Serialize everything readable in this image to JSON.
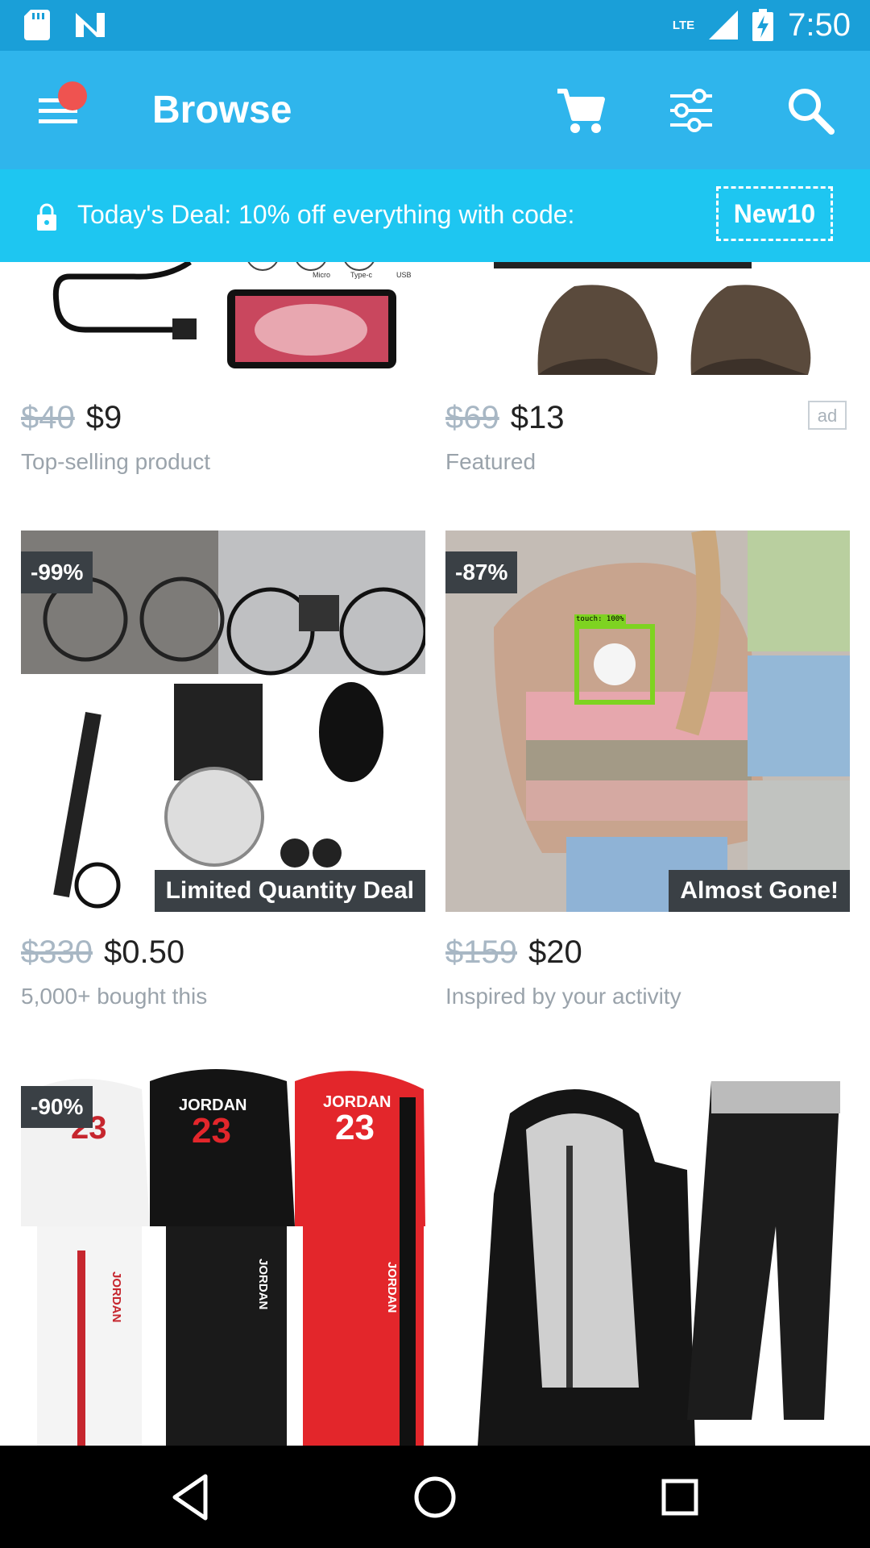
{
  "status_bar": {
    "time": "7:50",
    "network": "LTE",
    "left_icons": [
      "sd-card-icon",
      "n-logo-icon"
    ]
  },
  "app_bar": {
    "title": "Browse",
    "icons": [
      "menu-icon",
      "cart-icon",
      "filter-icon",
      "search-icon"
    ],
    "notification_dot_color": "#ef5350"
  },
  "deal_banner": {
    "text": "Today's Deal: 10% off everything with code:",
    "code": "New10"
  },
  "products": [
    {
      "old_price": "$40",
      "new_price": "$9",
      "subtitle": "Top-selling product",
      "image": "usb-endoscope-camera",
      "image_labels": [
        "Micro",
        "Type-c",
        "USB"
      ]
    },
    {
      "old_price": "$69",
      "new_price": "$13",
      "subtitle": "Featured",
      "ad_label": "ad",
      "image": "leather-flat-caps"
    },
    {
      "badge": "-99%",
      "tag": "Limited Quantity Deal",
      "old_price": "$330",
      "new_price": "$0.50",
      "subtitle": "5,000+ bought this",
      "image": "bicycle-engine-kit"
    },
    {
      "badge": "-87%",
      "tag": "Almost Gone!",
      "old_price": "$159",
      "new_price": "$20",
      "subtitle": "Inspired by your activity",
      "image": "knit-hoodie-sweater",
      "touch_overlay": "touch: 100%"
    },
    {
      "badge": "-90%",
      "image": "jordan-tracksuits",
      "image_labels": [
        "JORDAN",
        "23",
        "JORDAN",
        "23",
        "23",
        "JORDAN",
        "JORDAN",
        "JORDAN"
      ]
    },
    {
      "image": "fleece-hoodie-tracksuit"
    }
  ],
  "nav_bar": {
    "buttons": [
      "back-icon",
      "home-icon",
      "recents-icon"
    ]
  },
  "colors": {
    "status_bar": "#1a9fd8",
    "app_bar": "#2fb5ec",
    "deal_banner": "#1ec6f1",
    "badge": "#3a4045",
    "touch_box": "#7ed321"
  }
}
